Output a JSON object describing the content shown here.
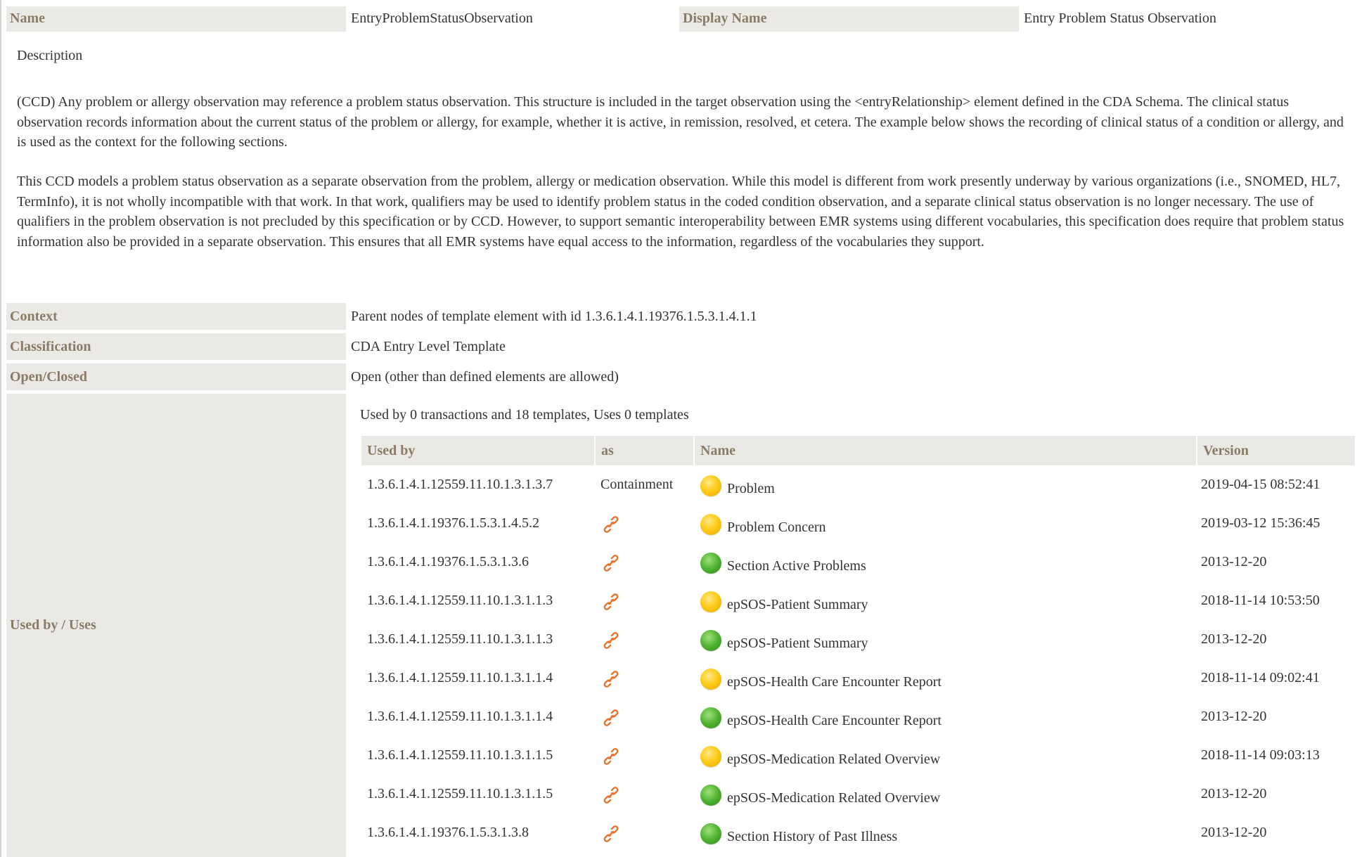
{
  "header": {
    "name_label": "Name",
    "name_value": "EntryProblemStatusObservation",
    "display_name_label": "Display Name",
    "display_name_value": "Entry Problem Status Observation"
  },
  "description": {
    "title": "Description",
    "paragraph1": "(CCD) Any problem or allergy observation may reference a problem status observation. This structure is included in the target observation using the <entryRelationship> element defined in the CDA Schema. The clinical status observation records information about the current status of the problem or allergy, for example, whether it is active, in remission, resolved, et cetera. The example below shows the recording of clinical status of a condition or allergy, and is used as the context for the following sections.",
    "paragraph2": "This CCD models a problem status observation as a separate observation from the problem, allergy or medication observation. While this model is different from work presently underway by various organizations (i.e., SNOMED, HL7, TermInfo), it is not wholly incompatible with that work. In that work, qualifiers may be used to identify problem status in the coded condition observation, and a separate clinical status observation is no longer necessary. The use of qualifiers in the problem observation is not precluded by this specification or by CCD. However, to support semantic interoperability between EMR systems using different vocabularies, this specification does require that problem status information also be provided in a separate observation. This ensures that all EMR systems have equal access to the information, regardless of the vocabularies they support."
  },
  "properties": {
    "context_label": "Context",
    "context_value": "Parent nodes of template element with id 1.3.6.1.4.1.19376.1.5.3.1.4.1.1",
    "classification_label": "Classification",
    "classification_value": "CDA Entry Level Template",
    "open_closed_label": "Open/Closed",
    "open_closed_value": "Open (other than defined elements are allowed)",
    "used_by_label": "Used by / Uses"
  },
  "usage": {
    "summary": "Used by 0 transactions and 18 templates, Uses 0 templates",
    "columns": {
      "used_by": "Used by",
      "as": "as",
      "name": "Name",
      "version": "Version"
    },
    "colors": {
      "yellow": "#ffcc1a",
      "green": "#4fb330",
      "link": "#e8742a"
    },
    "rows": [
      {
        "id": "1.3.6.1.4.1.12559.11.10.1.3.1.3.7",
        "as": "Containment",
        "as_icon": "",
        "status": "yellow",
        "name": "Problem",
        "version": "2019-04-15 08:52:41"
      },
      {
        "id": "1.3.6.1.4.1.19376.1.5.3.1.4.5.2",
        "as": "",
        "as_icon": "link-icon",
        "status": "yellow",
        "name": "Problem Concern",
        "version": "2019-03-12 15:36:45"
      },
      {
        "id": "1.3.6.1.4.1.19376.1.5.3.1.3.6",
        "as": "",
        "as_icon": "link-icon",
        "status": "green",
        "name": "Section Active Problems",
        "version": "2013-12-20"
      },
      {
        "id": "1.3.6.1.4.1.12559.11.10.1.3.1.1.3",
        "as": "",
        "as_icon": "link-icon",
        "status": "yellow",
        "name": "epSOS-Patient Summary",
        "version": "2018-11-14 10:53:50"
      },
      {
        "id": "1.3.6.1.4.1.12559.11.10.1.3.1.1.3",
        "as": "",
        "as_icon": "link-icon",
        "status": "green",
        "name": "epSOS-Patient Summary",
        "version": "2013-12-20"
      },
      {
        "id": "1.3.6.1.4.1.12559.11.10.1.3.1.1.4",
        "as": "",
        "as_icon": "link-icon",
        "status": "yellow",
        "name": "epSOS-Health Care Encounter Report",
        "version": "2018-11-14 09:02:41"
      },
      {
        "id": "1.3.6.1.4.1.12559.11.10.1.3.1.1.4",
        "as": "",
        "as_icon": "link-icon",
        "status": "green",
        "name": "epSOS-Health Care Encounter Report",
        "version": "2013-12-20"
      },
      {
        "id": "1.3.6.1.4.1.12559.11.10.1.3.1.1.5",
        "as": "",
        "as_icon": "link-icon",
        "status": "yellow",
        "name": "epSOS-Medication Related Overview",
        "version": "2018-11-14 09:03:13"
      },
      {
        "id": "1.3.6.1.4.1.12559.11.10.1.3.1.1.5",
        "as": "",
        "as_icon": "link-icon",
        "status": "green",
        "name": "epSOS-Medication Related Overview",
        "version": "2013-12-20"
      },
      {
        "id": "1.3.6.1.4.1.19376.1.5.3.1.3.8",
        "as": "",
        "as_icon": "link-icon",
        "status": "green",
        "name": "Section History of Past Illness",
        "version": "2013-12-20"
      }
    ]
  }
}
